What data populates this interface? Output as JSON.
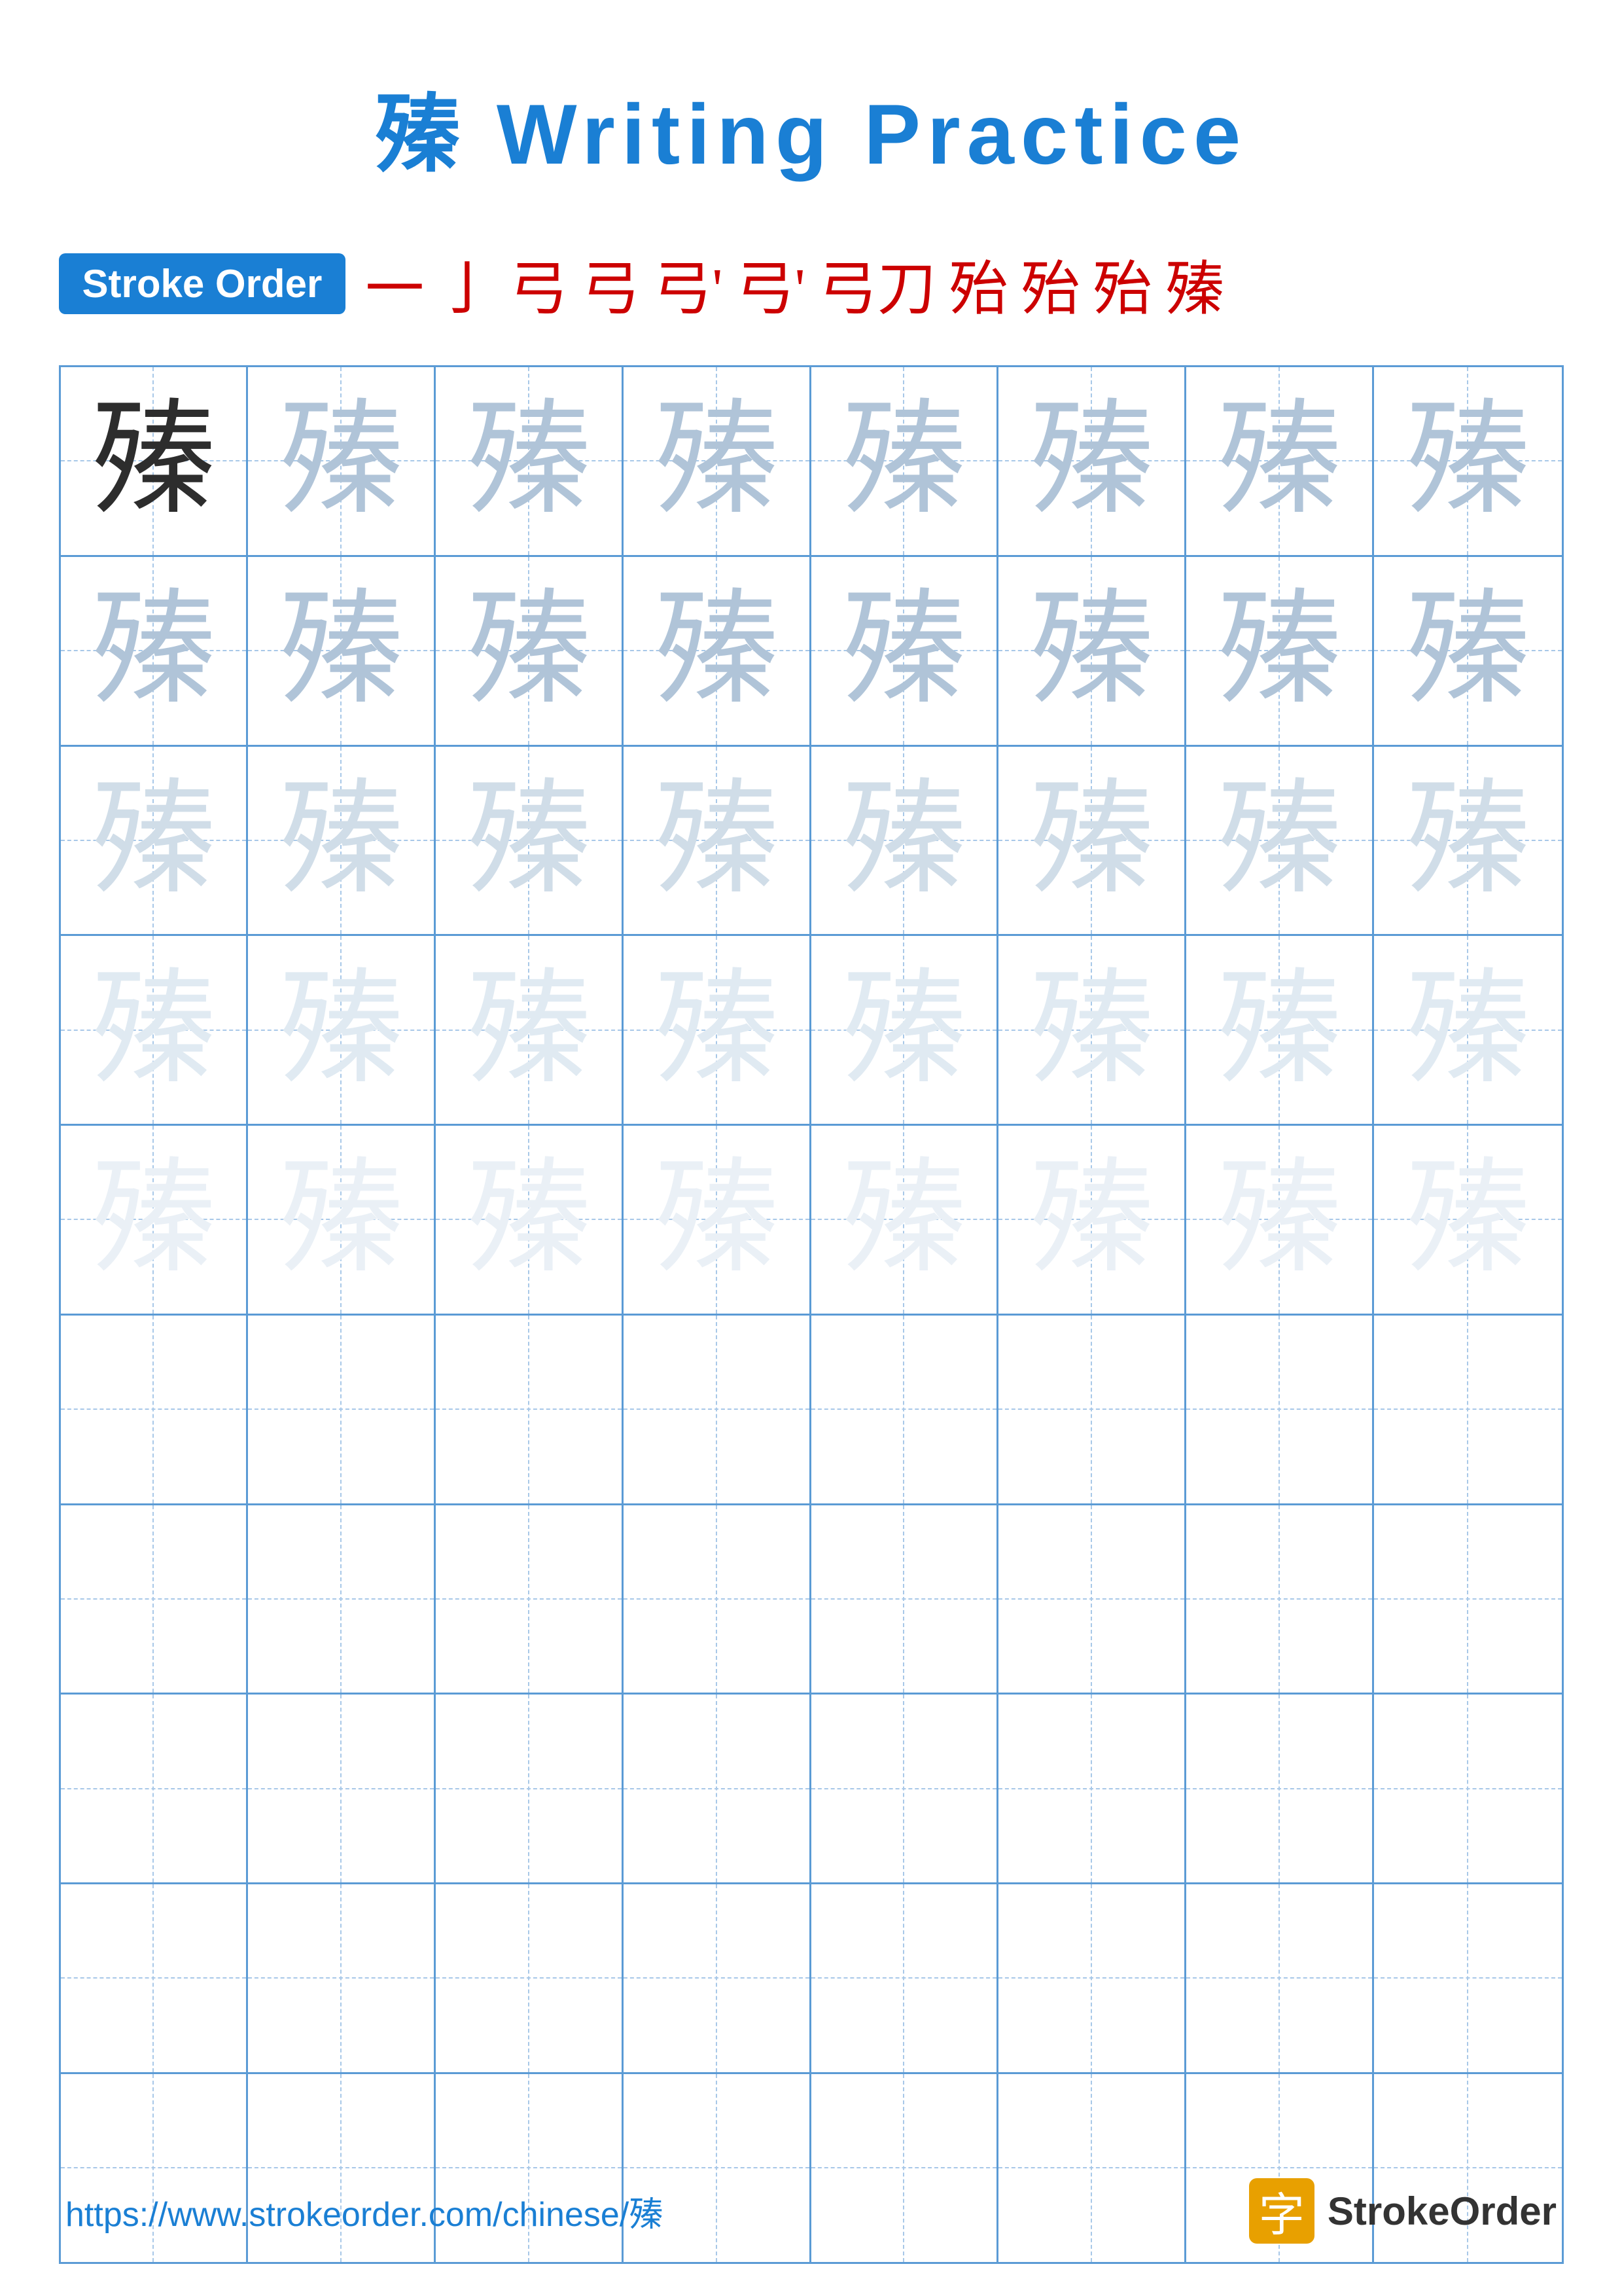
{
  "title": "殝 Writing Practice",
  "stroke_order": {
    "badge_label": "Stroke Order",
    "chars": [
      "一",
      "亅",
      "弓",
      "弓",
      "弓'",
      "弓'",
      "弓刀",
      "殆",
      "殆",
      "殆",
      "殝"
    ]
  },
  "character": "殝",
  "grid": {
    "rows": 10,
    "cols": 8,
    "filled_rows": 5,
    "empty_rows": 5
  },
  "footer": {
    "url": "https://www.strokeorder.com/chinese/殝",
    "logo_icon": "字",
    "logo_text": "StrokeOrder"
  }
}
